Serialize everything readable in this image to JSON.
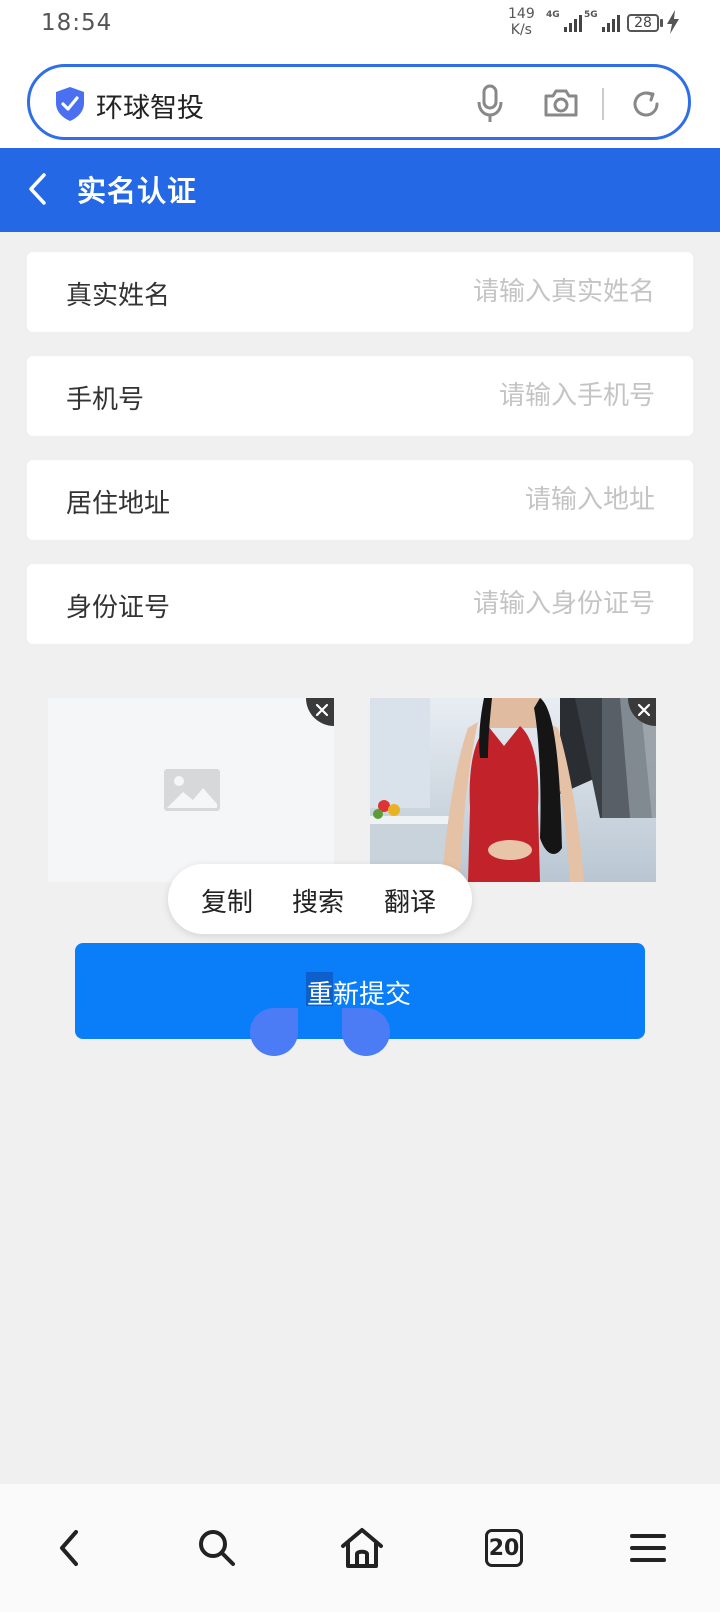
{
  "status_bar": {
    "time": "18:54",
    "net_speed_value": "149",
    "net_speed_unit": "K/s",
    "signal1_tag": "4G",
    "signal2_tag": "5G",
    "battery": "28"
  },
  "browser": {
    "site_name": "环球智投",
    "accent_color": "#2f6ee6"
  },
  "header": {
    "title": "实名认证",
    "background_color": "#2468e6"
  },
  "form": {
    "rows": [
      {
        "label": "真实姓名",
        "placeholder": "请输入真实姓名"
      },
      {
        "label": "手机号",
        "placeholder": "请输入手机号"
      },
      {
        "label": "居住地址",
        "placeholder": "请输入地址"
      },
      {
        "label": "身份证号",
        "placeholder": "请输入身份证号"
      }
    ]
  },
  "context_menu": {
    "items": [
      "复制",
      "搜索",
      "翻译"
    ]
  },
  "submit": {
    "label_selected": "重",
    "label_rest": "新提交",
    "color": "#0a7ef8"
  },
  "bottom_nav": {
    "tab_count": "20"
  }
}
